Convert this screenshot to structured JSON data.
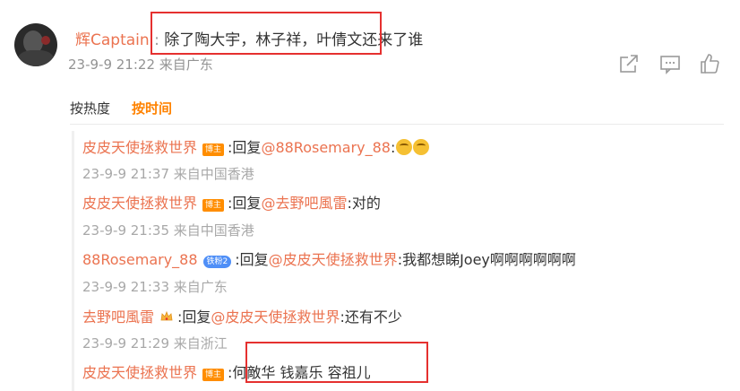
{
  "post": {
    "username": "辉Captain",
    "separator": ":",
    "text": "除了陶大宇，林子祥，叶倩文还来了谁",
    "meta": "23-9-9 21:22 来自广东"
  },
  "icons": [
    "share-icon",
    "comment-icon",
    "like-icon"
  ],
  "sort": {
    "hot": "按热度",
    "time": "按时间",
    "active": "time"
  },
  "replies": [
    {
      "name": "皮皮天使拯救世界",
      "badge": "博主",
      "text_before": ":回复",
      "at": "@88Rosemary_88",
      "text_after": ":",
      "emoji_count": 2,
      "meta": "23-9-9 21:37 来自中国香港"
    },
    {
      "name": "皮皮天使拯救世界",
      "badge": "博主",
      "text_before": ":回复",
      "at": "@去野吧風雷",
      "text_after": ":对的",
      "meta": "23-9-9 21:35 来自中国香港"
    },
    {
      "name": "88Rosemary_88",
      "badge": "铁粉2",
      "text_before": ":回复",
      "at": "@皮皮天使拯救世界",
      "text_after": ":我都想睇Joey啊啊啊啊啊啊",
      "meta": "23-9-9 21:33 来自广东"
    },
    {
      "name": "去野吧風雷",
      "text_before": ":回复",
      "at": "@皮皮天使拯救世界",
      "text_after": ":还有不少",
      "meta": "23-9-9 21:29 来自浙江"
    },
    {
      "name": "皮皮天使拯救世界",
      "badge": "博主",
      "text_before": ":",
      "text_after": "何敵华 钱嘉乐 容祖儿"
    }
  ],
  "colors": {
    "username": "#eb7350",
    "active_sort": "#ff8200",
    "highlight_box": "#e5302f",
    "meta": "#a8a8a8"
  }
}
